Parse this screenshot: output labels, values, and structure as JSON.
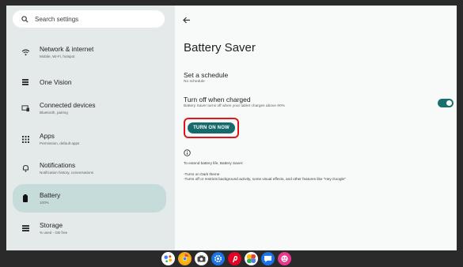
{
  "search": {
    "placeholder": "Search settings"
  },
  "nav": [
    {
      "id": "network",
      "title": "Network & internet",
      "sub": "Mobile, Wi-Fi, hotspot",
      "icon": "wifi-icon"
    },
    {
      "id": "onevision",
      "title": "One Vision",
      "sub": "",
      "icon": "grid-icon"
    },
    {
      "id": "devices",
      "title": "Connected devices",
      "sub": "Bluetooth, pairing",
      "icon": "devices-icon"
    },
    {
      "id": "apps",
      "title": "Apps",
      "sub": "Permission, default apps",
      "icon": "apps-icon"
    },
    {
      "id": "notifications",
      "title": "Notifications",
      "sub": "Notification history, conversations",
      "icon": "bell-icon"
    },
    {
      "id": "battery",
      "title": "Battery",
      "sub": "100%",
      "icon": "battery-icon",
      "selected": true
    },
    {
      "id": "storage",
      "title": "Storage",
      "sub": "% used - GB free",
      "icon": "storage-icon"
    }
  ],
  "detail": {
    "page_title": "Battery Saver",
    "schedule_title": "Set a schedule",
    "schedule_sub": "No schedule",
    "charged_title": "Turn off when charged",
    "charged_sub": "Battery Saver turns off when your tablet charges above 90%",
    "button_label": "TURN ON NOW",
    "footer_intro": "To extend battery life, Battery Saver:",
    "footer_line1": "-Turns on Dark theme",
    "footer_line2": "-Turns off or restricts background activity, some visual effects, and other features like \"Hey Google\""
  },
  "colors": {
    "accent": "#176a6c",
    "highlight": "#e0161b",
    "selected_nav": "#c6dcdb"
  },
  "taskbar": [
    "assistant-icon",
    "chrome-icon",
    "camera-icon",
    "settings-icon",
    "pinterest-icon",
    "photos-icon",
    "chat-icon",
    "game-icon"
  ]
}
